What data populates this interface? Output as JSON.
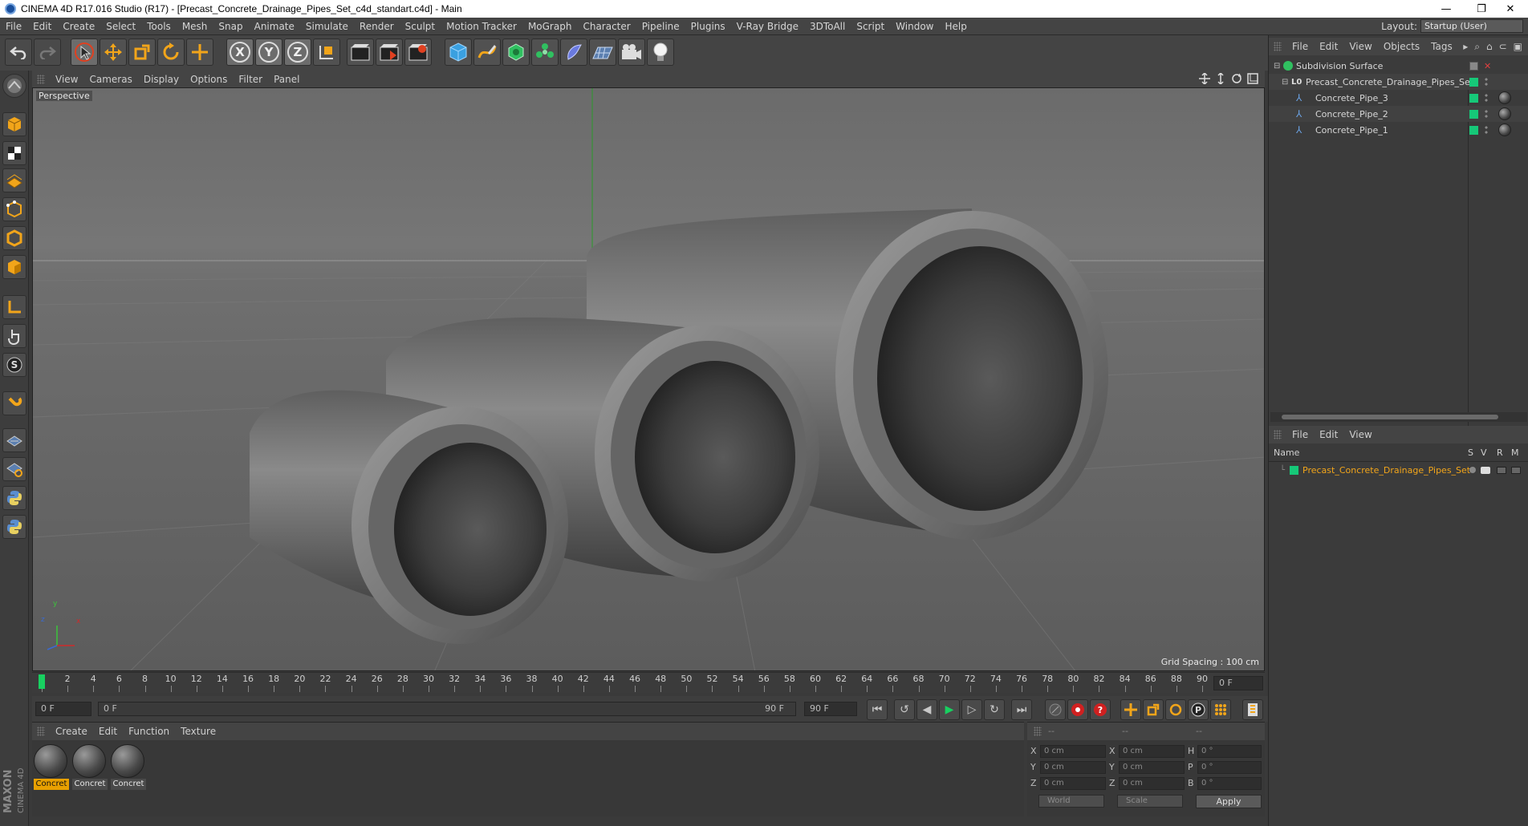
{
  "window": {
    "title": "CINEMA 4D R17.016 Studio (R17) - [Precast_Concrete_Drainage_Pipes_Set_c4d_standart.c4d] - Main",
    "minimize": "—",
    "restore": "❐",
    "close": "✕"
  },
  "menubar": {
    "items": [
      "File",
      "Edit",
      "Create",
      "Select",
      "Tools",
      "Mesh",
      "Snap",
      "Animate",
      "Simulate",
      "Render",
      "Sculpt",
      "Motion Tracker",
      "MoGraph",
      "Character",
      "Pipeline",
      "Plugins",
      "V-Ray Bridge",
      "3DToAll",
      "Script",
      "Window",
      "Help"
    ],
    "layout_label": "Layout:",
    "layout_value": "Startup (User)"
  },
  "toolbar": {
    "axis_x": "X",
    "axis_y": "Y",
    "axis_z": "Z"
  },
  "viewport": {
    "menu": [
      "View",
      "Cameras",
      "Display",
      "Options",
      "Filter",
      "Panel"
    ],
    "label": "Perspective",
    "grid_spacing": "Grid Spacing : 100 cm",
    "axis_y": "y",
    "axis_z": "z",
    "axis_x": "x"
  },
  "timeline": {
    "ticks": [
      "0",
      "2",
      "4",
      "6",
      "8",
      "10",
      "12",
      "14",
      "16",
      "18",
      "20",
      "22",
      "24",
      "26",
      "28",
      "30",
      "32",
      "34",
      "36",
      "38",
      "40",
      "42",
      "44",
      "46",
      "48",
      "50",
      "52",
      "54",
      "56",
      "58",
      "60",
      "62",
      "64",
      "66",
      "68",
      "70",
      "72",
      "74",
      "76",
      "78",
      "80",
      "82",
      "84",
      "86",
      "88",
      "90"
    ],
    "end_field": "0 F",
    "current_frame": "0 F",
    "range_start": "0 F",
    "range_end": "90 F",
    "max_frame": "90 F"
  },
  "materials": {
    "menu": [
      "Create",
      "Edit",
      "Function",
      "Texture"
    ],
    "items": [
      {
        "label": "Concret",
        "active": true
      },
      {
        "label": "Concret",
        "active": false
      },
      {
        "label": "Concret",
        "active": false
      }
    ]
  },
  "coordinates": {
    "headers": [
      "--",
      "--",
      "--"
    ],
    "rows": [
      {
        "a1": "X",
        "v1": "0 cm",
        "a2": "X",
        "v2": "0 cm",
        "a3": "H",
        "v3": "0 °"
      },
      {
        "a1": "Y",
        "v1": "0 cm",
        "a2": "Y",
        "v2": "0 cm",
        "a3": "P",
        "v3": "0 °"
      },
      {
        "a1": "Z",
        "v1": "0 cm",
        "a2": "Z",
        "v2": "0 cm",
        "a3": "B",
        "v3": "0 °"
      }
    ],
    "space": "World",
    "mode": "Scale",
    "apply": "Apply"
  },
  "objects_panel": {
    "menu": [
      "File",
      "Edit",
      "View",
      "Objects",
      "Tags"
    ],
    "items": [
      {
        "name": "Subdivision Surface",
        "indent": 0
      },
      {
        "name": "Precast_Concrete_Drainage_Pipes_Set",
        "indent": 1
      },
      {
        "name": "Concrete_Pipe_3",
        "indent": 2
      },
      {
        "name": "Concrete_Pipe_2",
        "indent": 2
      },
      {
        "name": "Concrete_Pipe_1",
        "indent": 2
      }
    ]
  },
  "layers_panel": {
    "menu": [
      "File",
      "Edit",
      "View"
    ],
    "col_name": "Name",
    "col_s": "S",
    "col_v": "V",
    "col_r": "R",
    "col_m": "M",
    "item": "Precast_Concrete_Drainage_Pipes_Set"
  },
  "branding": {
    "maxon": "MAXON",
    "c4d": "CINEMA 4D"
  },
  "colors": {
    "accent_orange": "#e8a000",
    "object_green": "#16c878",
    "viewport_bg": "#6d6d6d"
  }
}
